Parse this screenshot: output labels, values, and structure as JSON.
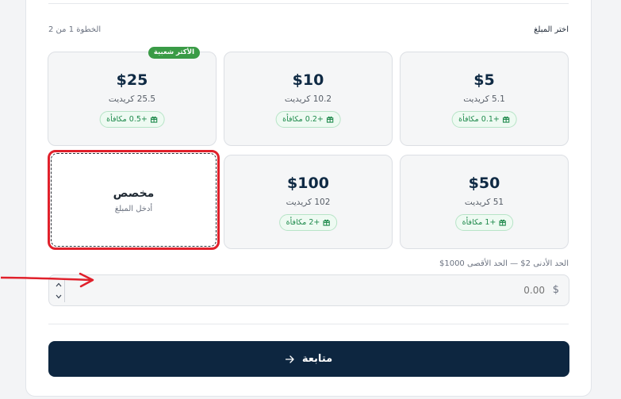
{
  "header": {
    "choose_amount": "اختر المبلغ",
    "step": "الخطوة 1 من 2"
  },
  "packages": [
    {
      "price": "$5",
      "credits": "5.1 كريديت",
      "bonus": "+0.1 مكافأة"
    },
    {
      "price": "$10",
      "credits": "10.2 كريديت",
      "bonus": "+0.2 مكافأة"
    },
    {
      "price": "$25",
      "credits": "25.5 كريديت",
      "bonus": "+0.5 مكافأة",
      "badge": "الأكثر شعبية"
    },
    {
      "price": "$50",
      "credits": "51 كريديت",
      "bonus": "+1 مكافأة"
    },
    {
      "price": "$100",
      "credits": "102 كريديت",
      "bonus": "+2 مكافأة"
    }
  ],
  "custom": {
    "title": "مخصص",
    "hint": "أدخل المبلغ"
  },
  "amount": {
    "limits": "الحد الأدنى 2$ — الحد الأقصى 1000$",
    "currency": "$",
    "placeholder": "0.00"
  },
  "continue_label": "متابعة",
  "colors": {
    "primary": "#0d2640",
    "bonus_green": "#1f8a4c",
    "badge_green": "#3a9b46",
    "highlight_red": "#e0202b"
  }
}
